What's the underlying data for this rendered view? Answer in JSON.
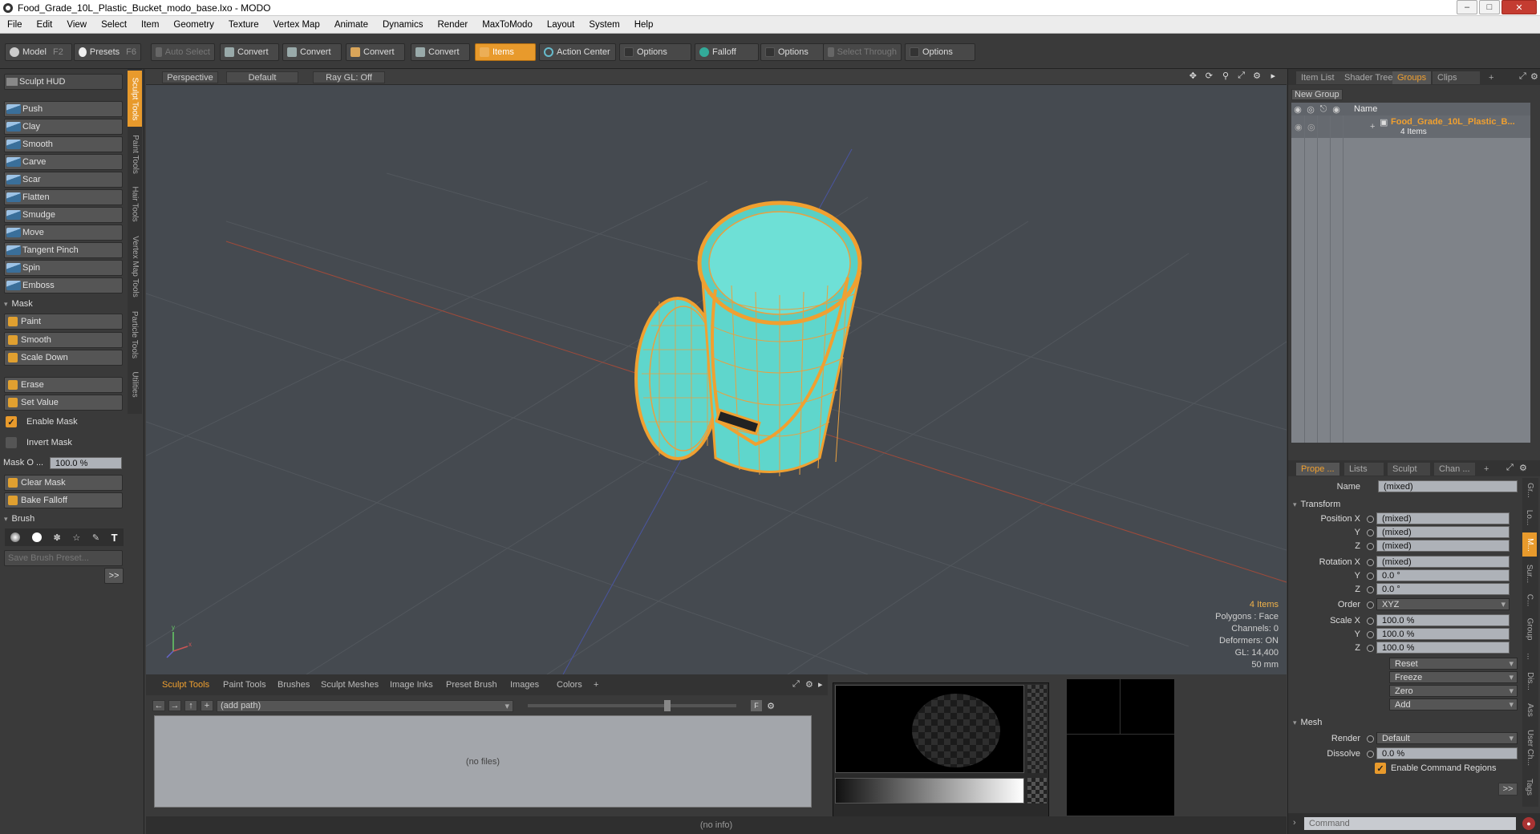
{
  "window": {
    "title": "Food_Grade_10L_Plastic_Bucket_modo_base.lxo - MODO"
  },
  "menu": [
    "File",
    "Edit",
    "View",
    "Select",
    "Item",
    "Geometry",
    "Texture",
    "Vertex Map",
    "Animate",
    "Dynamics",
    "Render",
    "MaxToModo",
    "Layout",
    "System",
    "Help"
  ],
  "toolbar": {
    "model": "Model",
    "model_key": "F2",
    "presets": "Presets",
    "presets_key": "F6",
    "auto_select": "Auto Select",
    "convert1": "Convert",
    "convert2": "Convert",
    "convert3": "Convert",
    "convert4": "Convert",
    "items": "Items",
    "action_center": "Action Center",
    "options1": "Options",
    "falloff": "Falloff",
    "options2": "Options",
    "select_through": "Select Through",
    "options3": "Options"
  },
  "left": {
    "hud": "Sculpt HUD",
    "tools": [
      "Push",
      "Clay",
      "Smooth",
      "Carve",
      "Scar",
      "Flatten",
      "Smudge",
      "Move",
      "Tangent Pinch",
      "Spin",
      "Emboss"
    ],
    "mask_section": "Mask",
    "mask_tools": [
      "Paint",
      "Smooth",
      "Scale Down"
    ],
    "erase": "Erase",
    "set_value": "Set Value",
    "enable_mask": "Enable Mask",
    "invert_mask": "Invert Mask",
    "mask_opacity_label": "Mask O ...",
    "mask_opacity_value": "100.0 %",
    "clear_mask": "Clear Mask",
    "bake_falloff": "Bake Falloff",
    "brush_section": "Brush",
    "save_preset": "Save Brush Preset...",
    "more": ">>",
    "vtabs": [
      "Sculpt Tools",
      "Paint Tools",
      "Hair Tools",
      "Vertex Map Tools",
      "Particle Tools",
      "Utilities"
    ]
  },
  "viewport": {
    "view": "Perspective",
    "shading": "Default",
    "raygl": "Ray GL: Off",
    "info": {
      "items": "4 Items",
      "polygons": "Polygons : Face",
      "channels": "Channels: 0",
      "deformers": "Deformers: ON",
      "gl": "GL: 14,400",
      "size": "50 mm"
    }
  },
  "bottom": {
    "tabs": [
      "Sculpt Tools",
      "Paint Tools",
      "Brushes",
      "Sculpt Meshes",
      "Image Inks",
      "Preset Brush",
      "Images",
      "Colors",
      "+"
    ],
    "path": "(add path)",
    "nofiles": "(no files)",
    "status": "(no info)"
  },
  "right": {
    "tabs": [
      "Item List",
      "Shader Tree",
      "Groups",
      "Clips",
      "+"
    ],
    "new_group": "New Group",
    "col_name": "Name",
    "group_name": "Food_Grade_10L_Plastic_B...",
    "group_count": "4 Items",
    "prop_tabs": [
      "Prope ...",
      "Lists",
      "Sculpt",
      "Chan ...",
      "+"
    ],
    "name_label": "Name",
    "name_value": "(mixed)",
    "transform": "Transform",
    "position_label": "Position X",
    "pos": [
      "(mixed)",
      "(mixed)",
      "(mixed)"
    ],
    "rotation_label": "Rotation X",
    "rot": [
      "(mixed)",
      "0.0 °",
      "0.0 °"
    ],
    "order_label": "Order",
    "order": "XYZ",
    "scale_label": "Scale X",
    "scale": [
      "100.0 %",
      "100.0 %",
      "100.0 %"
    ],
    "y": "Y",
    "z": "Z",
    "reset": "Reset",
    "freeze": "Freeze",
    "zero": "Zero",
    "add": "Add",
    "mesh": "Mesh",
    "render_label": "Render",
    "render": "Default",
    "dissolve_label": "Dissolve",
    "dissolve": "0.0 %",
    "enable_cmd": "Enable Command Regions",
    "more": ">>",
    "command": "Command",
    "side_tabs": [
      "Gr...",
      "Lo...",
      "M...",
      "Sur...",
      "C...",
      "Group",
      "...",
      "Dis...",
      "Ass",
      "User Ch...",
      "Tags"
    ]
  }
}
